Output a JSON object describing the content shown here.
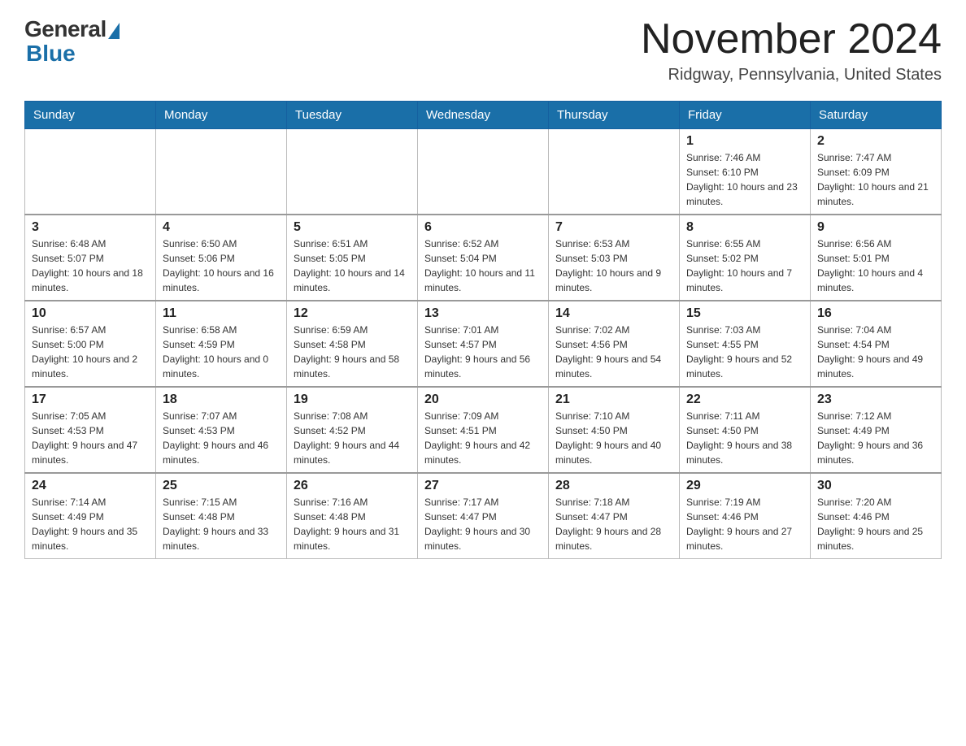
{
  "header": {
    "logo_general": "General",
    "logo_blue": "Blue",
    "month_title": "November 2024",
    "location": "Ridgway, Pennsylvania, United States"
  },
  "weekdays": [
    "Sunday",
    "Monday",
    "Tuesday",
    "Wednesday",
    "Thursday",
    "Friday",
    "Saturday"
  ],
  "weeks": [
    [
      {
        "day": "",
        "info": ""
      },
      {
        "day": "",
        "info": ""
      },
      {
        "day": "",
        "info": ""
      },
      {
        "day": "",
        "info": ""
      },
      {
        "day": "",
        "info": ""
      },
      {
        "day": "1",
        "info": "Sunrise: 7:46 AM\nSunset: 6:10 PM\nDaylight: 10 hours and 23 minutes."
      },
      {
        "day": "2",
        "info": "Sunrise: 7:47 AM\nSunset: 6:09 PM\nDaylight: 10 hours and 21 minutes."
      }
    ],
    [
      {
        "day": "3",
        "info": "Sunrise: 6:48 AM\nSunset: 5:07 PM\nDaylight: 10 hours and 18 minutes."
      },
      {
        "day": "4",
        "info": "Sunrise: 6:50 AM\nSunset: 5:06 PM\nDaylight: 10 hours and 16 minutes."
      },
      {
        "day": "5",
        "info": "Sunrise: 6:51 AM\nSunset: 5:05 PM\nDaylight: 10 hours and 14 minutes."
      },
      {
        "day": "6",
        "info": "Sunrise: 6:52 AM\nSunset: 5:04 PM\nDaylight: 10 hours and 11 minutes."
      },
      {
        "day": "7",
        "info": "Sunrise: 6:53 AM\nSunset: 5:03 PM\nDaylight: 10 hours and 9 minutes."
      },
      {
        "day": "8",
        "info": "Sunrise: 6:55 AM\nSunset: 5:02 PM\nDaylight: 10 hours and 7 minutes."
      },
      {
        "day": "9",
        "info": "Sunrise: 6:56 AM\nSunset: 5:01 PM\nDaylight: 10 hours and 4 minutes."
      }
    ],
    [
      {
        "day": "10",
        "info": "Sunrise: 6:57 AM\nSunset: 5:00 PM\nDaylight: 10 hours and 2 minutes."
      },
      {
        "day": "11",
        "info": "Sunrise: 6:58 AM\nSunset: 4:59 PM\nDaylight: 10 hours and 0 minutes."
      },
      {
        "day": "12",
        "info": "Sunrise: 6:59 AM\nSunset: 4:58 PM\nDaylight: 9 hours and 58 minutes."
      },
      {
        "day": "13",
        "info": "Sunrise: 7:01 AM\nSunset: 4:57 PM\nDaylight: 9 hours and 56 minutes."
      },
      {
        "day": "14",
        "info": "Sunrise: 7:02 AM\nSunset: 4:56 PM\nDaylight: 9 hours and 54 minutes."
      },
      {
        "day": "15",
        "info": "Sunrise: 7:03 AM\nSunset: 4:55 PM\nDaylight: 9 hours and 52 minutes."
      },
      {
        "day": "16",
        "info": "Sunrise: 7:04 AM\nSunset: 4:54 PM\nDaylight: 9 hours and 49 minutes."
      }
    ],
    [
      {
        "day": "17",
        "info": "Sunrise: 7:05 AM\nSunset: 4:53 PM\nDaylight: 9 hours and 47 minutes."
      },
      {
        "day": "18",
        "info": "Sunrise: 7:07 AM\nSunset: 4:53 PM\nDaylight: 9 hours and 46 minutes."
      },
      {
        "day": "19",
        "info": "Sunrise: 7:08 AM\nSunset: 4:52 PM\nDaylight: 9 hours and 44 minutes."
      },
      {
        "day": "20",
        "info": "Sunrise: 7:09 AM\nSunset: 4:51 PM\nDaylight: 9 hours and 42 minutes."
      },
      {
        "day": "21",
        "info": "Sunrise: 7:10 AM\nSunset: 4:50 PM\nDaylight: 9 hours and 40 minutes."
      },
      {
        "day": "22",
        "info": "Sunrise: 7:11 AM\nSunset: 4:50 PM\nDaylight: 9 hours and 38 minutes."
      },
      {
        "day": "23",
        "info": "Sunrise: 7:12 AM\nSunset: 4:49 PM\nDaylight: 9 hours and 36 minutes."
      }
    ],
    [
      {
        "day": "24",
        "info": "Sunrise: 7:14 AM\nSunset: 4:49 PM\nDaylight: 9 hours and 35 minutes."
      },
      {
        "day": "25",
        "info": "Sunrise: 7:15 AM\nSunset: 4:48 PM\nDaylight: 9 hours and 33 minutes."
      },
      {
        "day": "26",
        "info": "Sunrise: 7:16 AM\nSunset: 4:48 PM\nDaylight: 9 hours and 31 minutes."
      },
      {
        "day": "27",
        "info": "Sunrise: 7:17 AM\nSunset: 4:47 PM\nDaylight: 9 hours and 30 minutes."
      },
      {
        "day": "28",
        "info": "Sunrise: 7:18 AM\nSunset: 4:47 PM\nDaylight: 9 hours and 28 minutes."
      },
      {
        "day": "29",
        "info": "Sunrise: 7:19 AM\nSunset: 4:46 PM\nDaylight: 9 hours and 27 minutes."
      },
      {
        "day": "30",
        "info": "Sunrise: 7:20 AM\nSunset: 4:46 PM\nDaylight: 9 hours and 25 minutes."
      }
    ]
  ]
}
